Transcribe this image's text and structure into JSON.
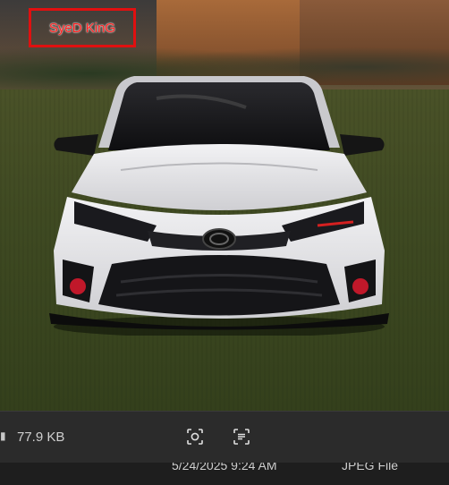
{
  "watermark": {
    "text": "SyeD KinG"
  },
  "info_bar": {
    "file_size": "77.9 KB",
    "icons": {
      "file": "file-icon",
      "visual_search": "visual-search-icon",
      "text_scan": "text-scan-icon"
    }
  },
  "bottom_bar": {
    "date_taken": "5/24/2025 9:24 AM",
    "file_type": "JPEG File"
  },
  "colors": {
    "watermark_border": "#e01010",
    "watermark_text": "#ff2020",
    "car_body": "#e8e8ea",
    "panel_bg": "#2b2b2b"
  }
}
